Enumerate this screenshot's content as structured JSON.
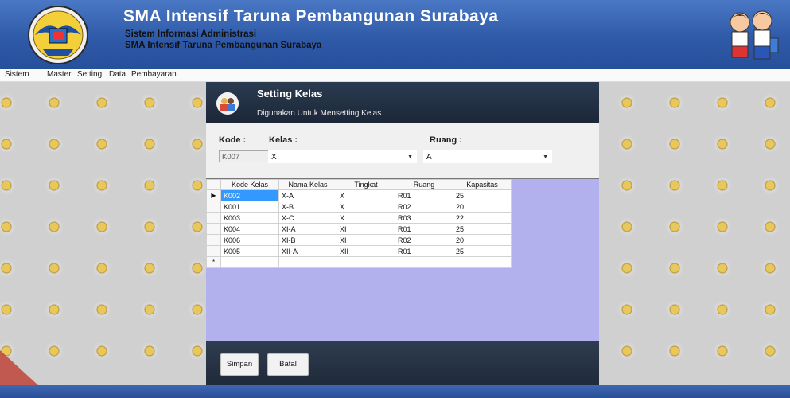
{
  "header": {
    "title": "SMA Intensif Taruna Pembangunan Surabaya",
    "subtitle1": "Sistem Informasi Administrasi",
    "subtitle2": "SMA Intensif Taruna Pembangunan Surabaya"
  },
  "menu": [
    "Sistem",
    "Master",
    "Setting",
    "Data",
    "Pembayaran"
  ],
  "form": {
    "title": "Setting Kelas",
    "description": "Digunakan Untuk Mensetting Kelas",
    "kode_label": "Kode :",
    "kode_value": "K007",
    "kelas_label": "Kelas  :",
    "kelas_value": "X",
    "ruang_label": "Ruang  :",
    "ruang_value": "A",
    "new_row_marker": "*",
    "save_label": "Simpan",
    "cancel_label": "Batal"
  },
  "grid": {
    "columns": [
      "Kode Kelas",
      "Nama Kelas",
      "Tingkat",
      "Ruang",
      "Kapasitas"
    ],
    "rows": [
      [
        "K002",
        "X-A",
        "X",
        "R01",
        "25"
      ],
      [
        "K001",
        "X-B",
        "X",
        "R02",
        "20"
      ],
      [
        "K003",
        "X-C",
        "X",
        "R03",
        "22"
      ],
      [
        "K004",
        "XI-A",
        "XI",
        "R01",
        "25"
      ],
      [
        "K006",
        "XI-B",
        "XI",
        "R02",
        "20"
      ],
      [
        "K005",
        "XII-A",
        "XII",
        "R01",
        "25"
      ]
    ],
    "selected_row": 0
  },
  "icons": {
    "logo": "school-emblem-icon",
    "kids": "students-illustration-icon",
    "form_icon": "users-icon",
    "row_indicator": "row-pointer-icon",
    "dropdown": "chevron-down-icon"
  },
  "colors": {
    "header_blue": "#2f5aa8",
    "form_header": "#1b2738",
    "grid_background": "#b3b0ee",
    "selection": "#3399ff"
  }
}
